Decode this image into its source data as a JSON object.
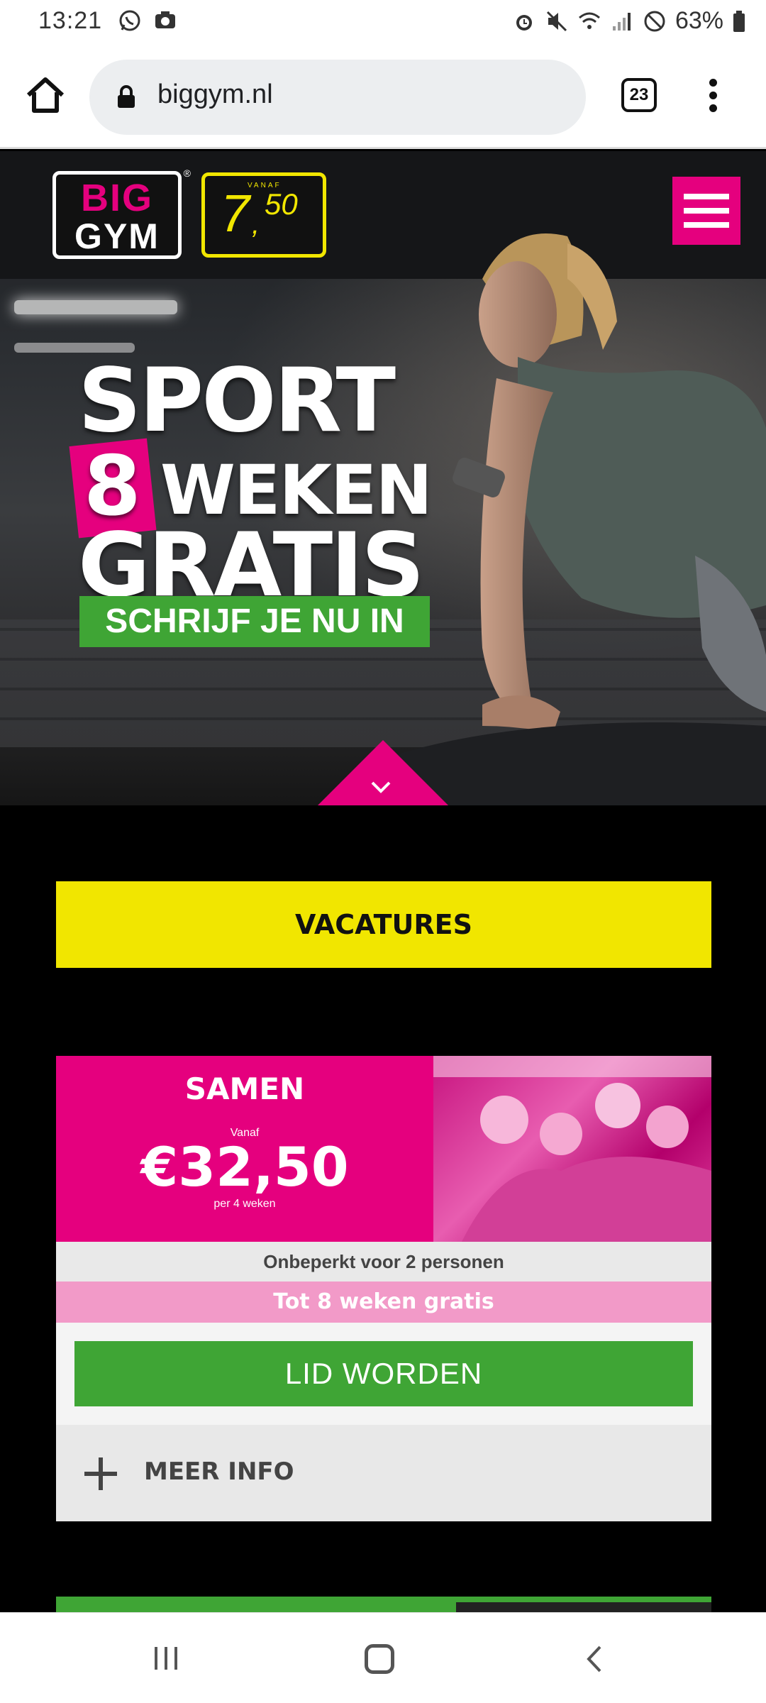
{
  "status_bar": {
    "time": "13:21",
    "battery": "63%",
    "icons_left": [
      "whatsapp-icon",
      "camera-icon"
    ],
    "icons_right": [
      "alarm-icon",
      "mute-icon",
      "wifi-icon",
      "signal-icon",
      "dnd-icon",
      "battery-icon"
    ]
  },
  "browser": {
    "url": "biggym.nl",
    "tab_count": "23"
  },
  "site": {
    "logo_top": "BIG",
    "logo_bottom": "GYM",
    "logo_reg": "®",
    "price_badge": {
      "vanaf": "VANAF",
      "euros": "7",
      "comma": ",",
      "cents": "50"
    }
  },
  "hero": {
    "line1": "SPORT",
    "number": "8",
    "line2": "WEKEN",
    "line3": "GRATIS",
    "cta": "SCHRIJF JE NU IN"
  },
  "vacatures": {
    "label": "VACATURES"
  },
  "card": {
    "title": "SAMEN",
    "vanaf": "Vanaf",
    "price": "€32,50",
    "per": "per 4 weken",
    "subtitle": "Onbeperkt voor 2 personen",
    "promo": "Tot 8 weken gratis",
    "button": "LID WORDEN",
    "more": "MEER INFO"
  },
  "colors": {
    "brand_pink": "#e5007e",
    "brand_yellow": "#f1e600",
    "brand_green": "#3fa535"
  }
}
